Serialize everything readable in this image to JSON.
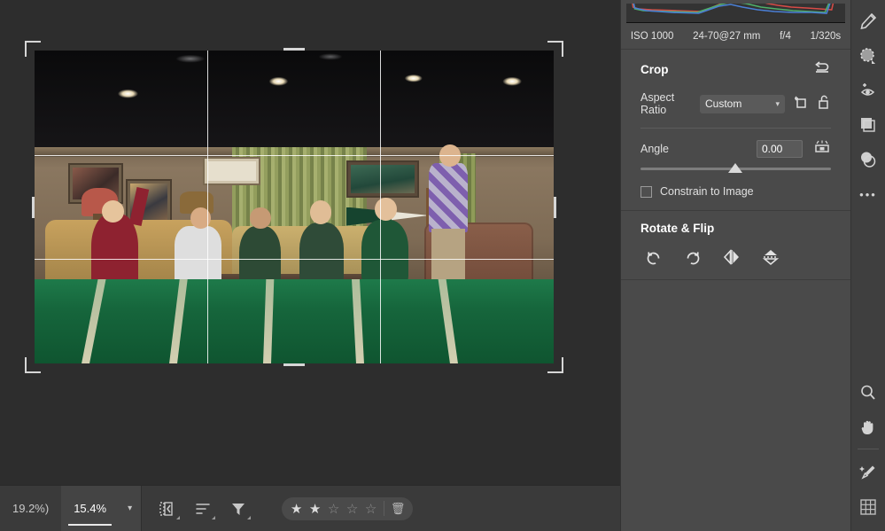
{
  "app": {
    "name": "photo-editor"
  },
  "histogram": {
    "channels": [
      "red",
      "green",
      "blue"
    ],
    "colors": {
      "red": "#d64b46",
      "green": "#4fb06a",
      "blue": "#4a7fd6"
    }
  },
  "exif": {
    "iso": "ISO 1000",
    "lens": "24-70@27 mm",
    "aperture": "f/4",
    "shutter": "1/320s"
  },
  "crop_panel": {
    "title": "Crop",
    "reset_icon": "reset-arrow-icon",
    "aspect_ratio_label": "Aspect Ratio",
    "aspect_ratio_value": "Custom",
    "aspect_ratio_options": [
      "Custom"
    ],
    "rotate_crop_icon": "rotate-crop-icon",
    "lock_icon": "unlock-icon",
    "angle_label": "Angle",
    "angle_value": "0.00",
    "angle_slider_percent": 46,
    "straighten_icon": "auto-straighten-icon",
    "constrain_label": "Constrain to Image",
    "constrain_checked": false
  },
  "rotate_flip_panel": {
    "title": "Rotate & Flip",
    "buttons": [
      {
        "name": "rotate-left-button",
        "icon": "rotate-ccw-icon"
      },
      {
        "name": "rotate-right-button",
        "icon": "rotate-cw-icon"
      },
      {
        "name": "flip-horizontal-button",
        "icon": "flip-horizontal-icon"
      },
      {
        "name": "flip-vertical-button",
        "icon": "flip-vertical-icon"
      }
    ]
  },
  "bottom_bar": {
    "zoom_previous": "19.2%)",
    "zoom_current": "15.4%",
    "zoom_dropdown_icon": "chevron-down-icon",
    "filmstrip_icon": "filmstrip-toggle-icon",
    "sort_icon": "sort-icon",
    "filter_icon": "filter-icon",
    "rating": {
      "value": 2,
      "max": 5,
      "star_filled": "★",
      "star_empty": "☆"
    },
    "delete_icon": "trash-icon",
    "view_single_icon": "single-view-icon",
    "view_compare_icon": "compare-view-icon"
  },
  "right_toolbar": {
    "top_tools": [
      {
        "name": "heal-brush-tool",
        "icon": "brush-icon"
      },
      {
        "name": "spot-removal-tool",
        "icon": "dotted-circle-icon"
      },
      {
        "name": "red-eye-tool",
        "icon": "eye-plus-icon"
      },
      {
        "name": "layers-tool",
        "icon": "layers-icon"
      },
      {
        "name": "mask-tool",
        "icon": "mask-circle-icon"
      },
      {
        "name": "more-tools",
        "icon": "ellipsis-icon"
      }
    ],
    "bottom_tools": [
      {
        "name": "zoom-tool",
        "icon": "magnifier-icon"
      },
      {
        "name": "pan-tool",
        "icon": "hand-icon"
      },
      {
        "name": "white-balance-tool",
        "icon": "eyedropper-icon"
      },
      {
        "name": "grid-tool",
        "icon": "grid-icon"
      }
    ]
  },
  "image": {
    "description": "stage-photograph-with-crop-overlay",
    "crop_grid": {
      "vertical_lines": 2,
      "horizontal_lines": 2
    }
  }
}
